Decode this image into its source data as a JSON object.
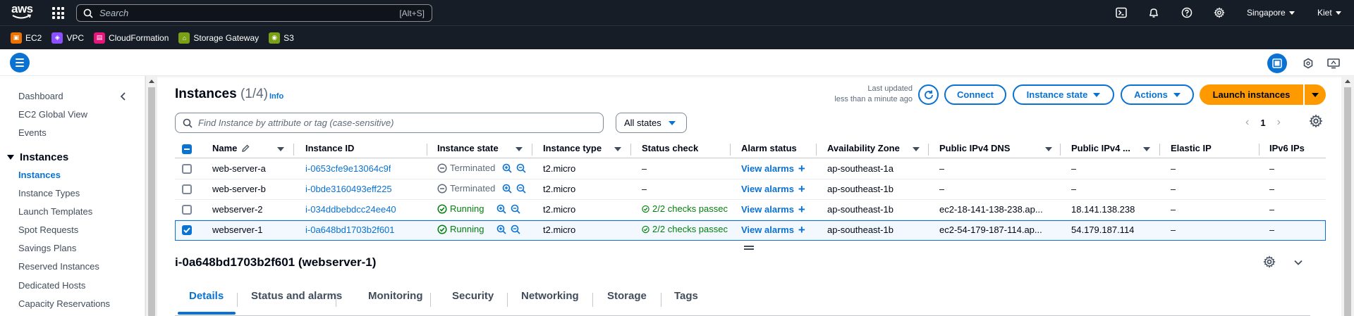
{
  "topnav": {
    "logo": "aws",
    "search_placeholder": "Search",
    "search_shortcut": "[Alt+S]",
    "region": "Singapore",
    "user": "Kiet"
  },
  "favorites": [
    {
      "label": "EC2",
      "color": "#ed7100"
    },
    {
      "label": "VPC",
      "color": "#8c4fff"
    },
    {
      "label": "CloudFormation",
      "color": "#e7157b"
    },
    {
      "label": "Storage Gateway",
      "color": "#7aa116"
    },
    {
      "label": "S3",
      "color": "#7aa116"
    }
  ],
  "sidebar": {
    "top_links": [
      "Dashboard",
      "EC2 Global View",
      "Events"
    ],
    "section": "Instances",
    "section_links": [
      "Instances",
      "Instance Types",
      "Launch Templates",
      "Spot Requests",
      "Savings Plans",
      "Reserved Instances",
      "Dedicated Hosts",
      "Capacity Reservations"
    ],
    "active": "Instances"
  },
  "header": {
    "title": "Instances",
    "count": "(1/4)",
    "info": "Info",
    "last_updated_line1": "Last updated",
    "last_updated_line2": "less than a minute ago",
    "connect": "Connect",
    "instance_state": "Instance state",
    "actions": "Actions",
    "launch": "Launch instances"
  },
  "filter": {
    "placeholder": "Find Instance by attribute or tag (case-sensitive)",
    "states": "All states",
    "page": "1"
  },
  "table": {
    "columns": [
      "Name",
      "Instance ID",
      "Instance state",
      "Instance type",
      "Status check",
      "Alarm status",
      "Availability Zone",
      "Public IPv4 DNS",
      "Public IPv4 ...",
      "Elastic IP",
      "IPv6 IPs"
    ],
    "rows": [
      {
        "name": "web-server-a",
        "id": "i-0653cfe9e13064c9f",
        "state": "Terminated",
        "state_kind": "terminated",
        "type": "t2.micro",
        "status": "–",
        "alarm": "View alarms",
        "az": "ap-southeast-1a",
        "dns": "–",
        "ipv4": "–",
        "eip": "–",
        "ipv6": "–",
        "selected": false
      },
      {
        "name": "web-server-b",
        "id": "i-0bde3160493eff225",
        "state": "Terminated",
        "state_kind": "terminated",
        "type": "t2.micro",
        "status": "–",
        "alarm": "View alarms",
        "az": "ap-southeast-1b",
        "dns": "–",
        "ipv4": "–",
        "eip": "–",
        "ipv6": "–",
        "selected": false
      },
      {
        "name": "webserver-2",
        "id": "i-034ddbebdcc24ee40",
        "state": "Running",
        "state_kind": "running",
        "type": "t2.micro",
        "status": "2/2 checks passec",
        "alarm": "View alarms",
        "az": "ap-southeast-1b",
        "dns": "ec2-18-141-138-238.ap...",
        "ipv4": "18.141.138.238",
        "eip": "–",
        "ipv6": "–",
        "selected": false
      },
      {
        "name": "webserver-1",
        "id": "i-0a648bd1703b2f601",
        "state": "Running",
        "state_kind": "running",
        "type": "t2.micro",
        "status": "2/2 checks passec",
        "alarm": "View alarms",
        "az": "ap-southeast-1b",
        "dns": "ec2-54-179-187-114.ap...",
        "ipv4": "54.179.187.114",
        "eip": "–",
        "ipv6": "–",
        "selected": true
      }
    ]
  },
  "details": {
    "title": "i-0a648bd1703b2f601 (webserver-1)",
    "tabs": [
      "Details",
      "Status and alarms",
      "Monitoring",
      "Security",
      "Networking",
      "Storage",
      "Tags"
    ],
    "active_tab": "Details"
  },
  "colors": {
    "accent": "#0972d3",
    "primary": "#ff9900",
    "running": "#037f0c",
    "nav_bg": "#161d26"
  }
}
